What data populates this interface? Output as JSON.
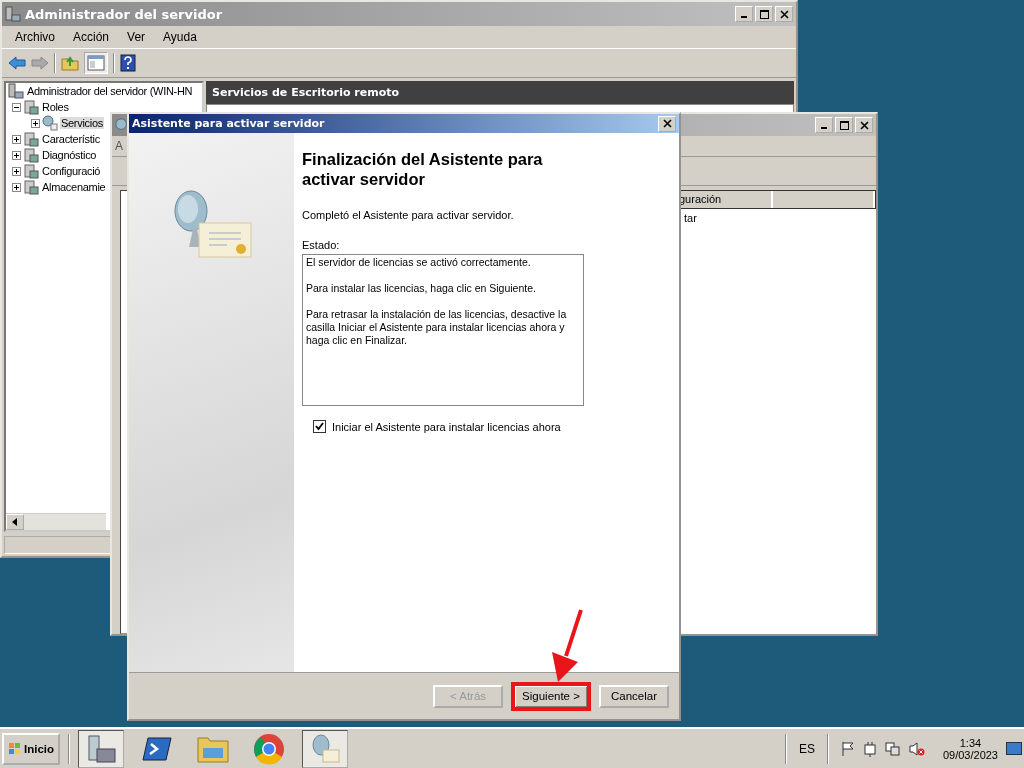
{
  "server_manager": {
    "title": "Administrador del servidor",
    "menu": [
      "Archivo",
      "Acción",
      "Ver",
      "Ayuda"
    ],
    "tree_root": "Administrador del servidor (WIN-HN",
    "tree": [
      {
        "label": "Roles",
        "expanded": true,
        "selected": false,
        "children": [
          {
            "label": "Servicios",
            "expanded": false,
            "selected": true
          }
        ]
      },
      {
        "label": "Característic",
        "expanded": false,
        "selected": false
      },
      {
        "label": "Diagnóstico",
        "expanded": false,
        "selected": false
      },
      {
        "label": "Configuració",
        "expanded": false,
        "selected": false
      },
      {
        "label": "Almacenamie",
        "expanded": false,
        "selected": false
      }
    ],
    "pane_title": "Servicios de Escritorio remoto"
  },
  "background_window": {
    "menu_fragment": "A",
    "column_1": "guración",
    "row_fragment": "tar"
  },
  "wizard": {
    "title": "Asistente para activar servidor",
    "heading": "Finalización del Asistente para activar servidor",
    "intro": "Completó el Asistente para activar servidor.",
    "status_label": "Estado:",
    "status_lines": [
      "El servidor de licencias se activó correctamente.",
      "Para instalar las licencias, haga clic en Siguiente.",
      "Para retrasar la instalación de las licencias, desactive la casilla Iniciar el Asistente para instalar licencias ahora y haga clic en Finalizar."
    ],
    "checkbox": {
      "label": "Iniciar el Asistente para instalar licencias ahora",
      "checked": true
    },
    "buttons": [
      {
        "label": "< Atrás",
        "disabled": true,
        "highlighted": false
      },
      {
        "label": "Siguiente >",
        "disabled": false,
        "highlighted": true
      },
      {
        "label": "Cancelar",
        "disabled": false,
        "highlighted": false
      }
    ]
  },
  "taskbar": {
    "start": "Inicio",
    "apps": [
      {
        "kind": "server",
        "active": true
      },
      {
        "kind": "terminal",
        "active": false
      },
      {
        "kind": "folder",
        "active": false
      },
      {
        "kind": "browser",
        "active": false
      },
      {
        "kind": "wizard",
        "active": true
      }
    ],
    "language": "ES",
    "time": "1:34",
    "date": "09/03/2023"
  }
}
